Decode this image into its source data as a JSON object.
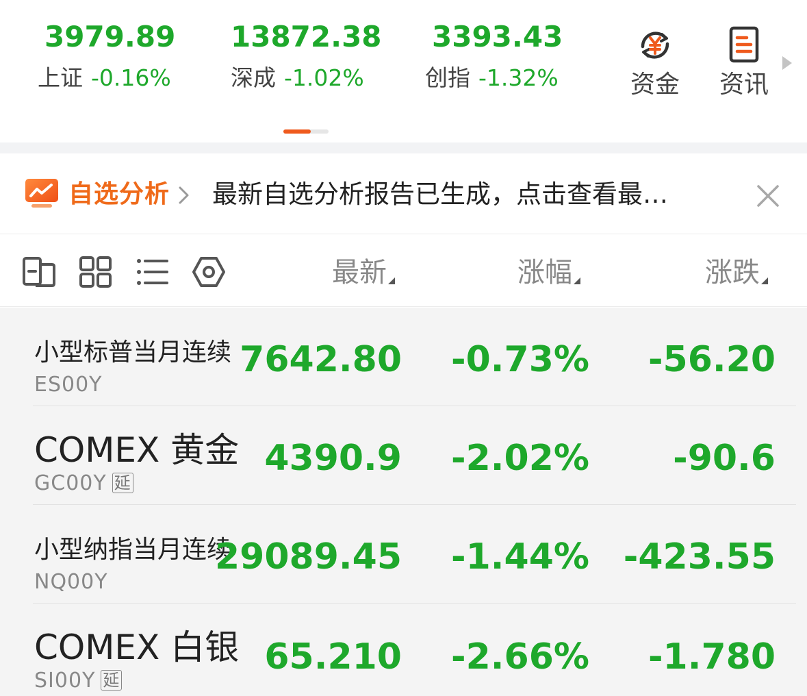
{
  "indices": [
    {
      "value": "3979.89",
      "name": "上证",
      "change_pct": "-0.16%"
    },
    {
      "value": "13872.38",
      "name": "深成",
      "change_pct": "-1.02%"
    },
    {
      "value": "3393.43",
      "name": "创指",
      "change_pct": "-1.32%"
    }
  ],
  "quick_links": {
    "capital_label": "资金",
    "news_label": "资讯"
  },
  "notice": {
    "title": "自选分析",
    "text": "最新自选分析报告已生成，点击查看最…"
  },
  "columns": {
    "latest": "最新",
    "change_pct": "涨幅",
    "change": "涨跌"
  },
  "rows": [
    {
      "name": "小型标普当月连续",
      "code": "ES00Y",
      "delayed": "",
      "latest": "7642.80",
      "change_pct": "-0.73%",
      "change": "-56.20"
    },
    {
      "name": "COMEX 黄金",
      "code": "GC00Y",
      "delayed": "延",
      "latest": "4390.9",
      "change_pct": "-2.02%",
      "change": "-90.6"
    },
    {
      "name": "小型纳指当月连续",
      "code": "NQ00Y",
      "delayed": "",
      "latest": "29089.45",
      "change_pct": "-1.44%",
      "change": "-423.55"
    },
    {
      "name": "COMEX 白银",
      "code": "SI00Y",
      "delayed": "延",
      "latest": "65.210",
      "change_pct": "-2.66%",
      "change": "-1.780"
    }
  ],
  "colors": {
    "down_green": "#1ea82b",
    "accent_orange": "#ef5a1d"
  },
  "icons": [
    "capital-yuan-icon",
    "news-document-icon",
    "analysis-chart-icon",
    "close-icon",
    "switch-layout-icon",
    "grid-view-icon",
    "list-view-icon",
    "settings-hexagon-icon"
  ]
}
